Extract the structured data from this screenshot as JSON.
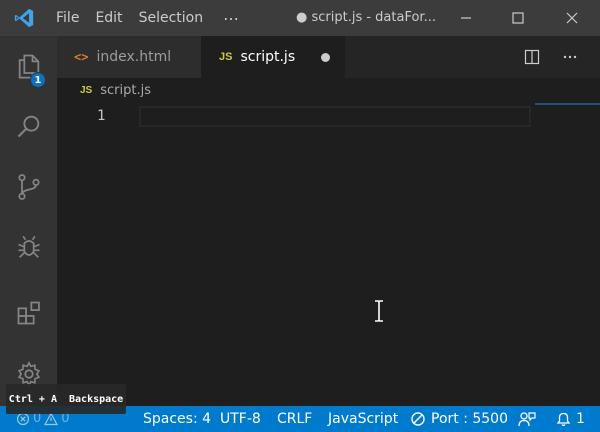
{
  "titlebar": {
    "menu": [
      "File",
      "Edit",
      "Selection"
    ],
    "more": "⋯",
    "window_title": "● script.js - dataFor..."
  },
  "activitybar": {
    "explorer_badge": "1",
    "icons": [
      "files-icon",
      "search-icon",
      "source-control-icon",
      "debug-icon",
      "extensions-icon",
      "settings-gear-icon"
    ]
  },
  "tabs": [
    {
      "icon": "<>",
      "label": "index.html",
      "active": false
    },
    {
      "icon": "JS",
      "label": "script.js",
      "active": true,
      "dirty": true
    }
  ],
  "breadcrumb": {
    "icon": "JS",
    "file": "script.js"
  },
  "editor": {
    "line_numbers": [
      "1"
    ],
    "lines": [
      ""
    ]
  },
  "statusbar": {
    "errors": "0",
    "warnings": "0",
    "spaces": "Spaces: 4",
    "encoding": "UTF-8",
    "eol": "CRLF",
    "language": "JavaScript",
    "port": "Port : 5500",
    "notifications": "1"
  },
  "keycast": {
    "text": "Ctrl + A  Backspace"
  },
  "colors": {
    "titlebar_bg": "#3c3c3c",
    "activitybar_bg": "#333333",
    "editor_bg": "#1e1e1e",
    "statusbar_bg": "#007acc",
    "badge_bg": "#0e70c0",
    "js_icon": "#cbcb41",
    "html_icon": "#e37933"
  }
}
